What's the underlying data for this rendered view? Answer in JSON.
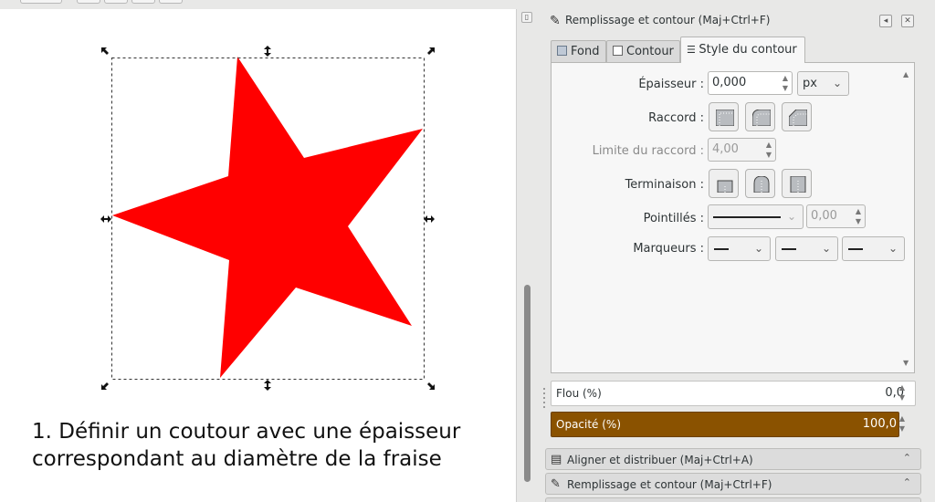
{
  "canvas": {
    "shape_fill": "#ff0000",
    "caption_lines": [
      "1. Définir un coutour avec une épaisseur",
      "correspondant au diamètre de la fraise"
    ]
  },
  "dock": {
    "title": "Remplissage et contour (Maj+Ctrl+F)",
    "title_icon": "pen-icon",
    "tabs": {
      "fill": "Fond",
      "stroke_paint": "Contour",
      "stroke_style": "Style du contour"
    },
    "stroke_style": {
      "width_label": "Épaisseur :",
      "width_value": "0,000",
      "unit": "px",
      "join_label": "Raccord :",
      "miter_label": "Limite du raccord :",
      "miter_value": "4,00",
      "cap_label": "Terminaison :",
      "dashes_label": "Pointillés :",
      "dash_offset": "0,00",
      "markers_label": "Marqueurs :"
    },
    "blur_label": "Flou (%)",
    "blur_value": "0,0",
    "opacity_label": "Opacité (%)",
    "opacity_value": "100,0",
    "opacity_color": "#8a5200",
    "collapsed_panels": [
      "Aligner et distribuer (Maj+Ctrl+A)",
      "Remplissage et contour (Maj+Ctrl+F)"
    ]
  }
}
